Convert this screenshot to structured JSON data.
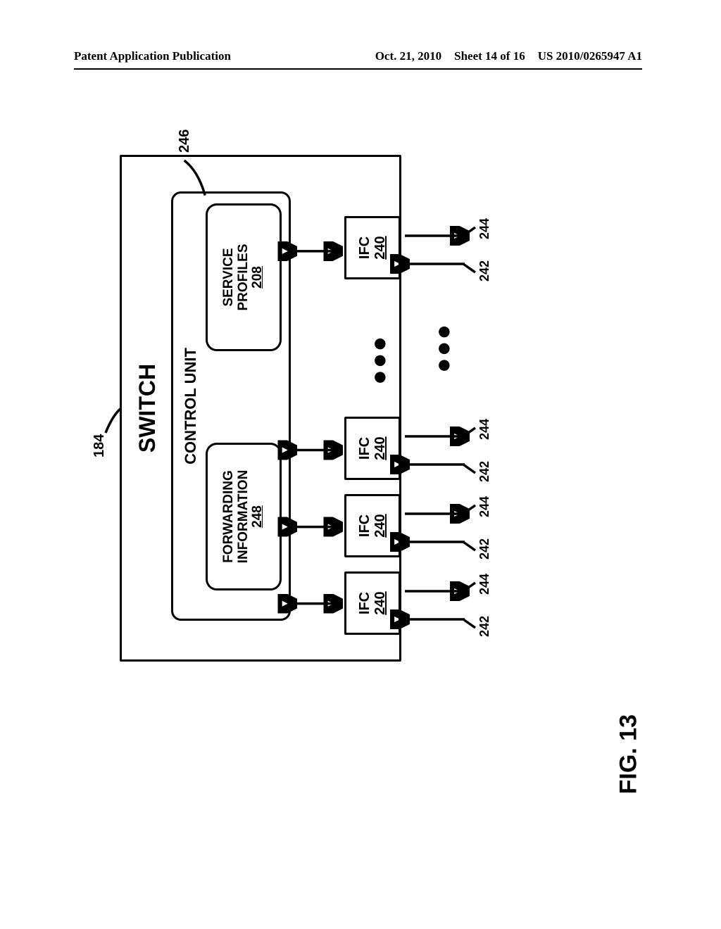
{
  "header": {
    "left": "Patent Application Publication",
    "date": "Oct. 21, 2010",
    "sheet": "Sheet 14 of 16",
    "pubno": "US 2010/0265947 A1"
  },
  "figure_label": "FIG. 13",
  "switch": {
    "title": "SWITCH",
    "ref": "184",
    "cu_ref": "246",
    "control_unit": {
      "title": "CONTROL UNIT",
      "fwd": {
        "label": "FORWARDING INFORMATION",
        "num": "248"
      },
      "sp": {
        "label": "SERVICE PROFILES",
        "num": "208"
      }
    },
    "ifc": {
      "label": "IFC",
      "num": "240"
    },
    "io": {
      "in_ref": "242",
      "out_ref": "244"
    },
    "ellipsis": "●●●"
  }
}
